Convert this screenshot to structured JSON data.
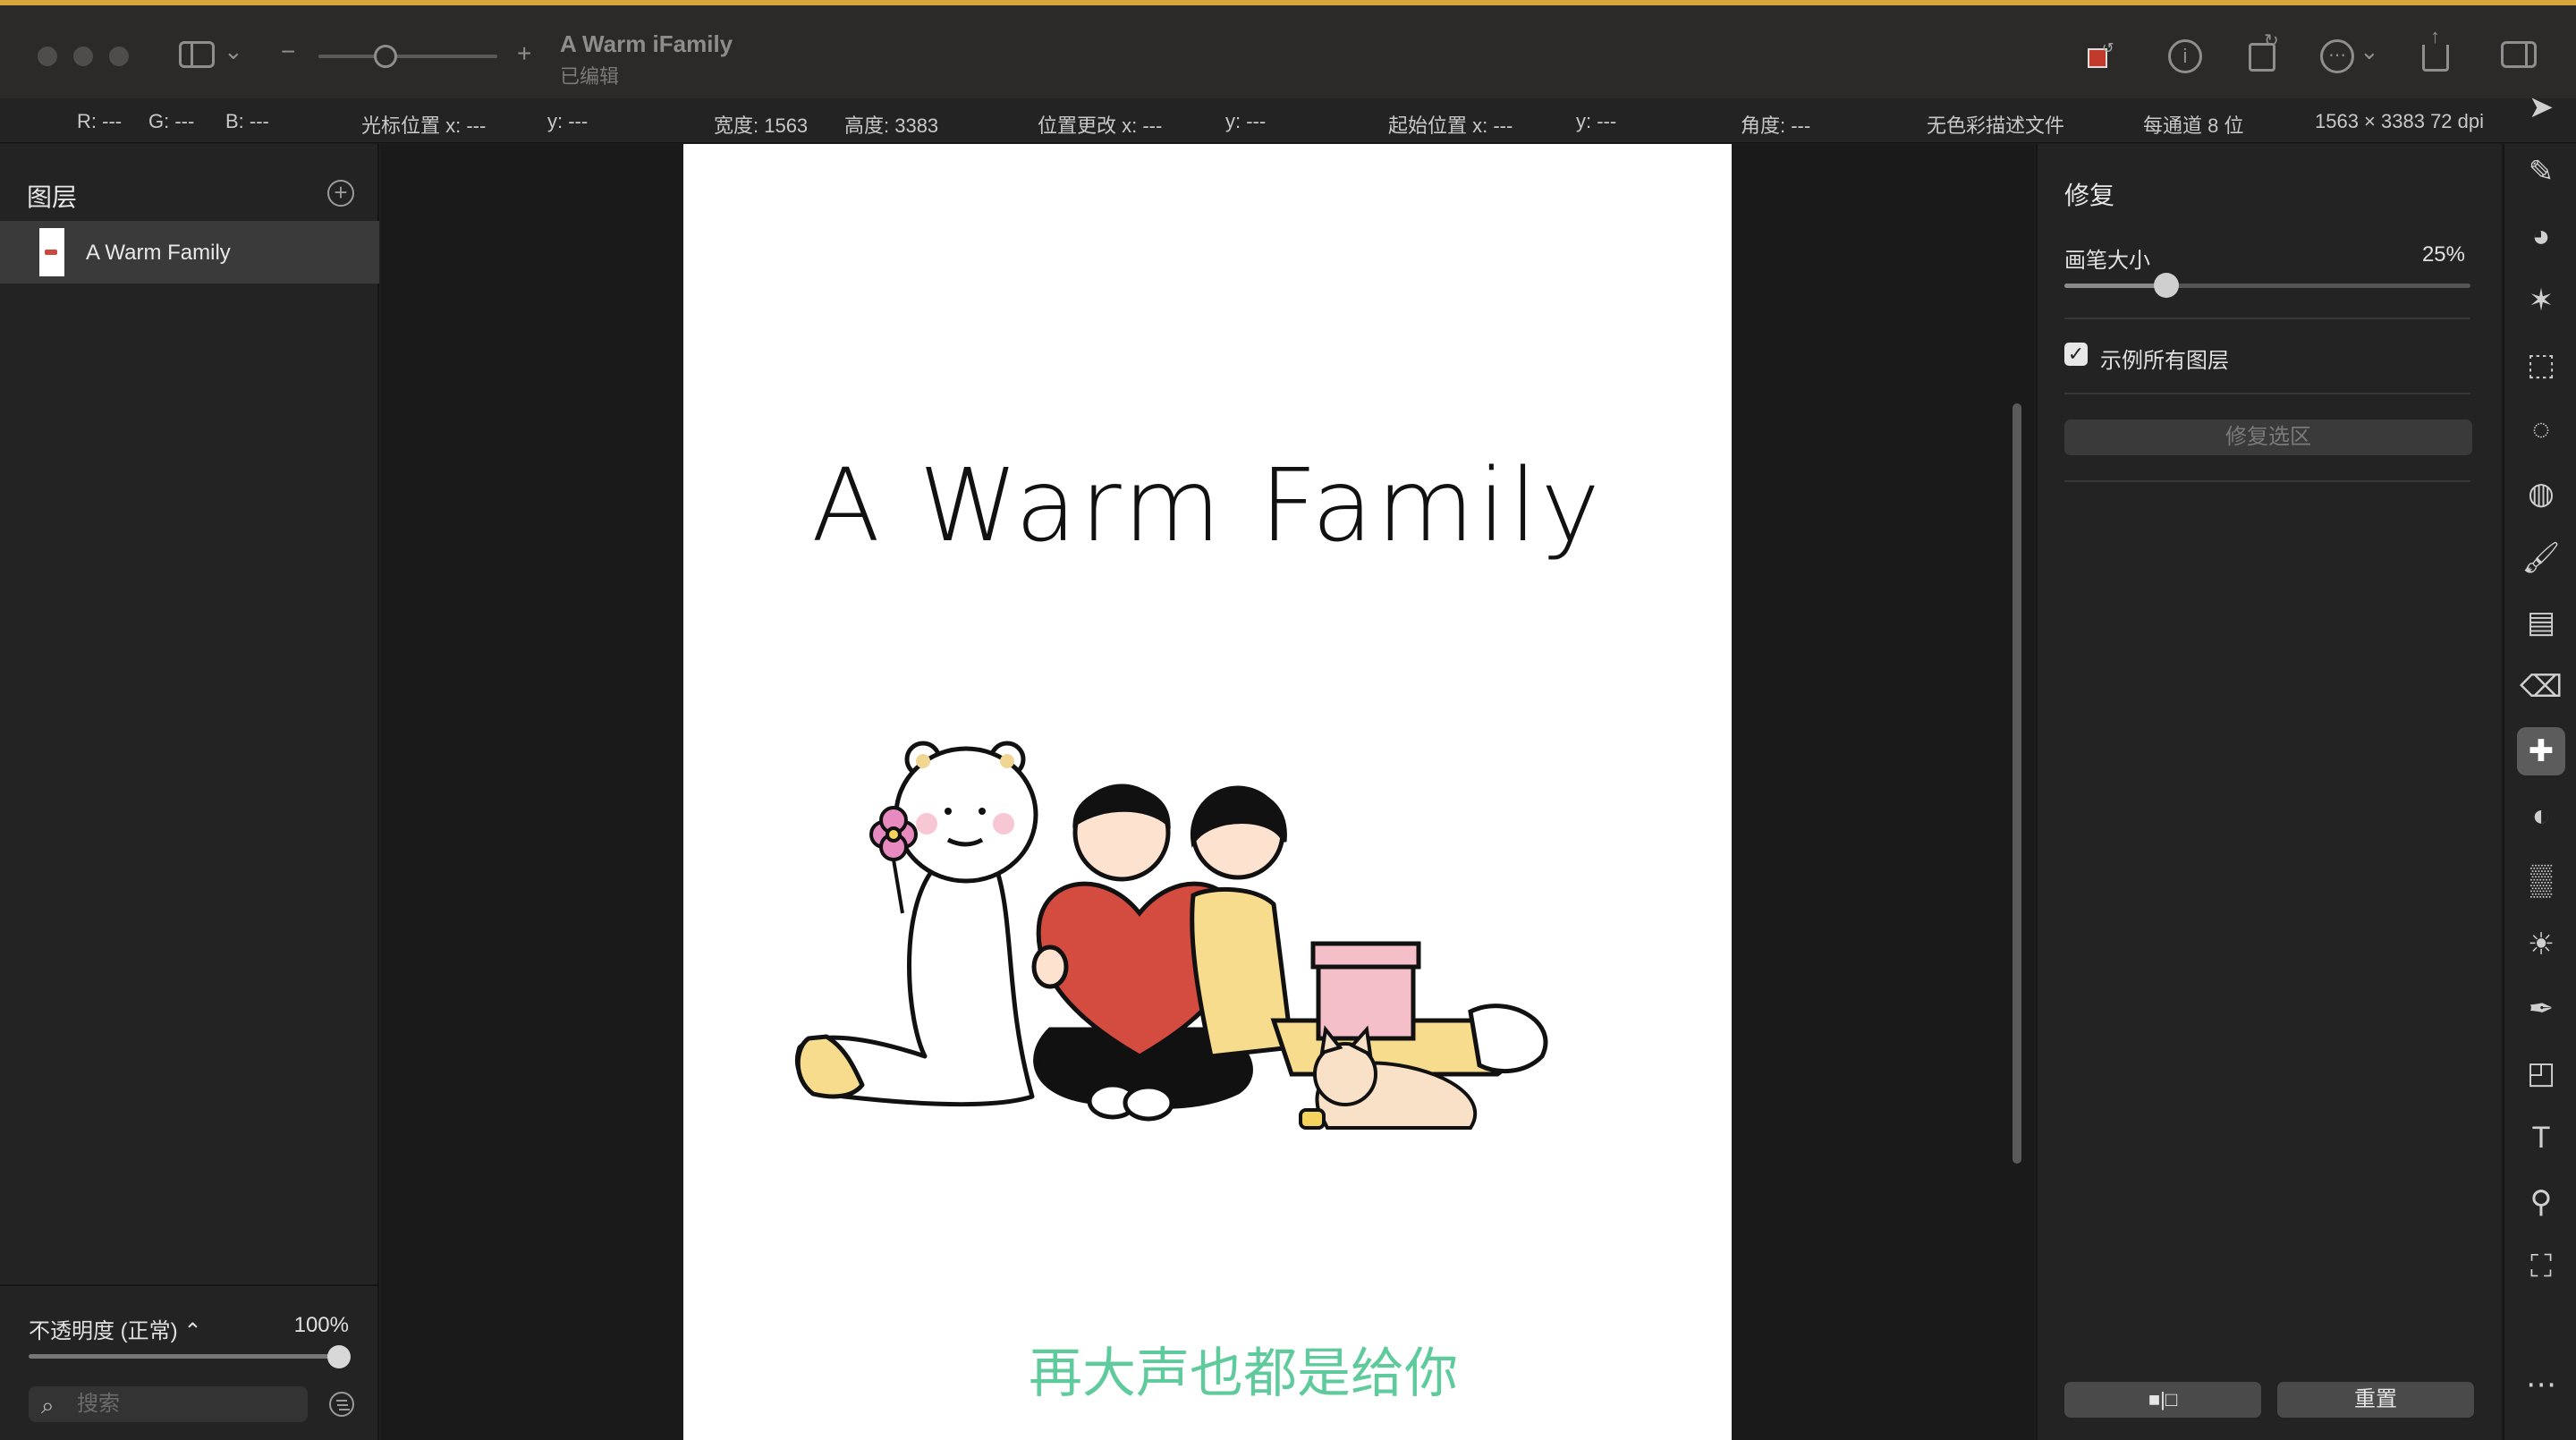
{
  "window": {
    "title": "A Warm iFamily",
    "subtitle": "已编辑"
  },
  "toolbar": {
    "sidebar_icon": "sidebar-icon",
    "zoom_minus": "−",
    "zoom_plus": "+",
    "zoom_level": 0.3
  },
  "infobar": {
    "r": "R: ---",
    "g": "G: ---",
    "b": "B: ---",
    "cursor_x": "光标位置 x: ---",
    "cursor_y": "y: ---",
    "width": "宽度: 1563",
    "height": "高度: 3383",
    "delta_x": "位置更改 x: ---",
    "delta_y": "y: ---",
    "origin_x": "起始位置 x: ---",
    "origin_y": "y: ---",
    "angle": "角度: ---",
    "profile": "无色彩描述文件",
    "bits": "每通道 8 位",
    "dims": "1563 × 3383 72 dpi"
  },
  "layers": {
    "title": "图层",
    "add_icon": "+",
    "items": [
      {
        "name": "A Warm Family"
      }
    ],
    "opacity_label": "不透明度 (正常) ⌃",
    "opacity_value": "100%",
    "search_placeholder": "搜索",
    "search_icon": "⌕"
  },
  "canvas": {
    "art_title": "A Warm Family",
    "lyric": "再大声也都是给你"
  },
  "repair": {
    "title": "修复",
    "brush_label": "画笔大小",
    "brush_value": "25%",
    "brush_fraction": 0.25,
    "sample_label": "示例所有图层",
    "sample_checked": "✓",
    "repair_select": "修复选区",
    "compare_label": "■|□",
    "reset_label": "重置"
  },
  "tools": [
    {
      "name": "arrow-tool",
      "glyph": "➤"
    },
    {
      "name": "style-tool",
      "glyph": "✎"
    },
    {
      "name": "color-adjust-tool",
      "glyph": "◕"
    },
    {
      "name": "effects-tool",
      "glyph": "✶"
    },
    {
      "name": "rect-select-tool",
      "glyph": "⬚"
    },
    {
      "name": "lasso-tool",
      "glyph": "◌"
    },
    {
      "name": "quick-select-tool",
      "glyph": "◍"
    },
    {
      "name": "brush-tool",
      "glyph": "🖌"
    },
    {
      "name": "gradient-tool",
      "glyph": "▤"
    },
    {
      "name": "eraser-tool",
      "glyph": "⌫"
    },
    {
      "name": "repair-tool",
      "glyph": "✚"
    },
    {
      "name": "clone-tool",
      "glyph": "◐"
    },
    {
      "name": "blur-tool",
      "glyph": "▒"
    },
    {
      "name": "exposure-tool",
      "glyph": "☀"
    },
    {
      "name": "pen-tool",
      "glyph": "✒"
    },
    {
      "name": "shape-tool",
      "glyph": "◰"
    },
    {
      "name": "text-tool",
      "glyph": "T"
    },
    {
      "name": "zoom-tool",
      "glyph": "⚲"
    },
    {
      "name": "crop-tool",
      "glyph": "⛶"
    },
    {
      "name": "more-tool",
      "glyph": "⋯"
    }
  ],
  "colors": {
    "accent_stripe": "#d8a53c",
    "lyric_green": "#5fcb9c",
    "heart_red": "#d44b40"
  }
}
